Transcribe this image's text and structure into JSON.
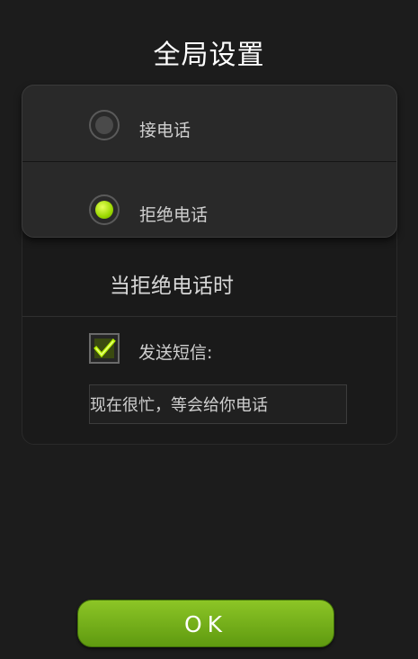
{
  "header": {
    "title": "全局设置"
  },
  "call_options": {
    "items": [
      {
        "label": "接电话",
        "selected": false
      },
      {
        "label": "拒绝电话",
        "selected": true
      }
    ]
  },
  "reject_section": {
    "title": "当拒绝电话时",
    "send_sms": {
      "label": "发送短信:",
      "checked": true
    },
    "message": {
      "value": "现在很忙，等会给你电话"
    }
  },
  "footer": {
    "ok_label": "OK"
  },
  "colors": {
    "accent": "#9bd800",
    "button": "#6fab18",
    "background": "#1c1c1c"
  }
}
